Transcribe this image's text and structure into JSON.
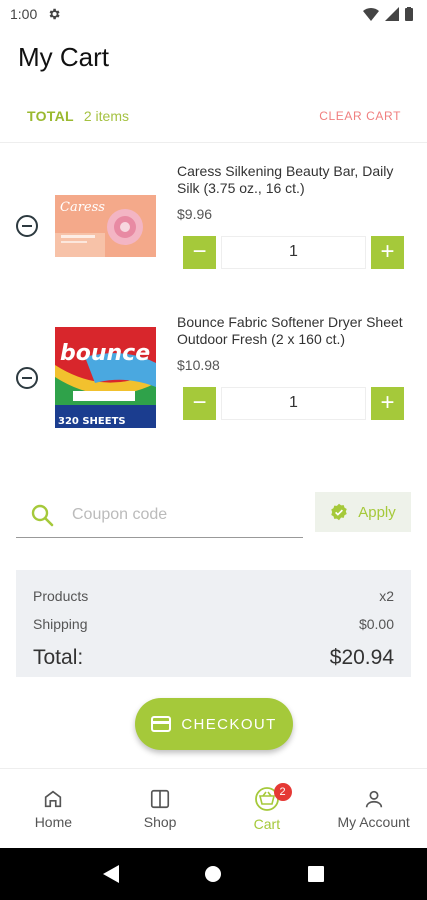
{
  "status": {
    "time": "1:00"
  },
  "header": {
    "title": "My Cart"
  },
  "cart": {
    "total_label": "TOTAL",
    "items_count": "2 items",
    "clear_label": "CLEAR CART",
    "items": [
      {
        "name": "Caress Silkening Beauty Bar, Daily Silk (3.75 oz., 16 ct.)",
        "price": "$9.96",
        "qty": "1",
        "img_brand": "Caress"
      },
      {
        "name": "Bounce Fabric Softener Dryer Sheet Outdoor Fresh (2 x 160 ct.)",
        "price": "$10.98",
        "qty": "1",
        "img_brand": "bounce",
        "img_caption": "320 SHEETS"
      }
    ]
  },
  "coupon": {
    "placeholder": "Coupon code",
    "apply_label": "Apply"
  },
  "summary": {
    "products_label": "Products",
    "products_value": "x2",
    "shipping_label": "Shipping",
    "shipping_value": "$0.00",
    "total_label": "Total:",
    "total_value": "$20.94"
  },
  "checkout": {
    "label": "CHECKOUT"
  },
  "bottom_nav": {
    "home": "Home",
    "shop": "Shop",
    "cart": "Cart",
    "cart_badge": "2",
    "account": "My Account"
  },
  "colors": {
    "accent": "#a5c93a",
    "clear": "#f07f7f",
    "badge": "#e53935"
  }
}
